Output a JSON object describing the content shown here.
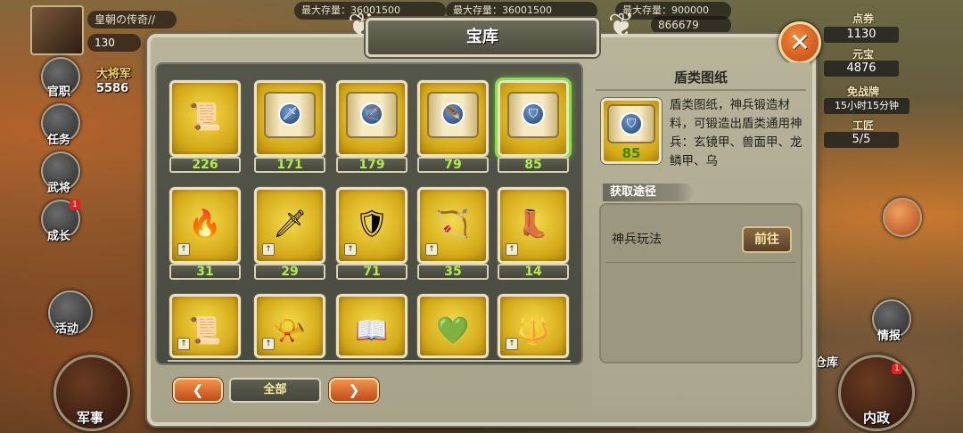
{
  "hud": {
    "player_name": "皇朝の传奇//",
    "level": "130",
    "general_title": "大将军",
    "general_value": "5586",
    "top_bars": [
      "最大存量：36001500",
      "最大存量：36001500",
      "最大存量：900000"
    ],
    "top_right_number": "866679",
    "points_label": "点券",
    "points_value": "1130",
    "yuanbao_label": "元宝",
    "yuanbao_value": "4876",
    "truce_label": "免战牌",
    "truce_value": "15小时15分钟",
    "team_label": "工匠",
    "team_value": "5/5",
    "left_menu": [
      "官职",
      "任务",
      "武将",
      "成长",
      "活动"
    ],
    "right_menu": [
      "情报",
      "仓库"
    ],
    "military": "军事",
    "internal": "内政",
    "badge_count": "1"
  },
  "dialog": {
    "title": "宝库",
    "close_symbol": "✕",
    "filter_label": "全部",
    "prev_symbol": "❮",
    "next_symbol": "❯"
  },
  "items": [
    {
      "name": "red-scroll",
      "icon": "📜",
      "count": "226"
    },
    {
      "name": "sword-blueprint",
      "icon": "🗡",
      "count": "171"
    },
    {
      "name": "bow-blueprint",
      "icon": "🏹",
      "count": "179"
    },
    {
      "name": "feather-blueprint",
      "icon": "🪶",
      "count": "79"
    },
    {
      "name": "shield-blueprint",
      "icon": "🛡",
      "count": "85"
    },
    {
      "name": "phoenix-feather",
      "icon": "🔥",
      "count": "31"
    },
    {
      "name": "twin-daggers",
      "icon": "🗡",
      "count": "29"
    },
    {
      "name": "jade-armor",
      "icon": "🛡",
      "count": "71"
    },
    {
      "name": "red-bow",
      "icon": "🏹",
      "count": "35"
    },
    {
      "name": "golden-boots",
      "icon": "👢",
      "count": "14"
    },
    {
      "name": "scroll-bundle",
      "icon": "📜",
      "count": ""
    },
    {
      "name": "war-horn",
      "icon": "📯",
      "count": ""
    },
    {
      "name": "golden-book",
      "icon": "📖",
      "count": ""
    },
    {
      "name": "jade-ring",
      "icon": "💚",
      "count": ""
    },
    {
      "name": "spear",
      "icon": "🔱",
      "count": ""
    }
  ],
  "detail": {
    "title": "盾类图纸",
    "count": "85",
    "description": "盾类图纸，神兵锻造材料，可锻造出盾类通用神兵：玄镜甲、兽面甲、龙鳞甲、乌",
    "source_heading": "获取途径",
    "source_name": "神兵玩法",
    "goto_label": "前往"
  },
  "colors": {
    "accent_green": "#7ee53a",
    "count_green": "#aef044",
    "close_orange": "#e06624",
    "card_gold": "#d3a817"
  }
}
